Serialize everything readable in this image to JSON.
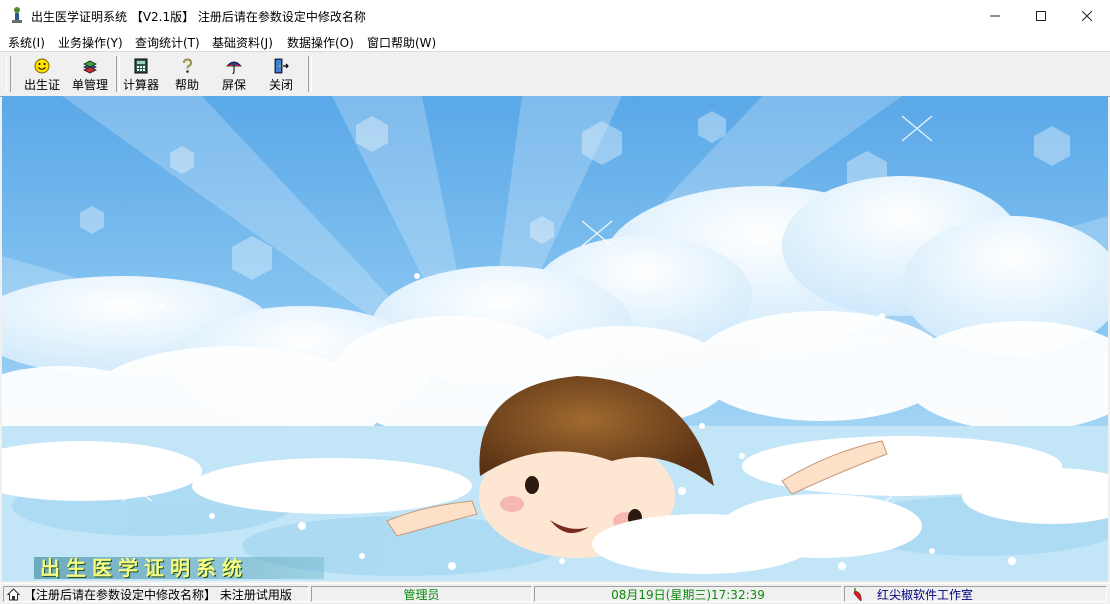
{
  "window": {
    "title": "出生医学证明系统 【V2.1版】 注册后请在参数设定中修改名称",
    "minimize_icon": "minimize-icon",
    "maximize_icon": "maximize-icon",
    "close_icon": "close-icon"
  },
  "menu": {
    "items": [
      {
        "label": "系统(I)"
      },
      {
        "label": "业务操作(Y)"
      },
      {
        "label": "查询统计(T)"
      },
      {
        "label": "基础资料(J)"
      },
      {
        "label": "数据操作(O)"
      },
      {
        "label": "窗口帮助(W)"
      }
    ]
  },
  "toolbar": {
    "buttons": [
      {
        "label": "出生证",
        "icon": "smiley-icon"
      },
      {
        "label": "单管理",
        "icon": "books-icon"
      },
      {
        "label": "计算器",
        "icon": "calculator-icon"
      },
      {
        "label": "帮助",
        "icon": "question-icon"
      },
      {
        "label": "屏保",
        "icon": "umbrella-icon"
      },
      {
        "label": "关闭",
        "icon": "exit-door-icon"
      }
    ]
  },
  "wallpaper": {
    "brand_text": "出生医学证明系统"
  },
  "statusbar": {
    "registration": "【注册后请在参数设定中修改名称】 未注册试用版",
    "user": "管理员",
    "datetime": "08月19日(星期三)17:32:39",
    "vendor": "红尖椒软件工作室",
    "user_color": "#0a8a0a",
    "datetime_color": "#0a8a0a",
    "vendor_color": "#000080"
  }
}
